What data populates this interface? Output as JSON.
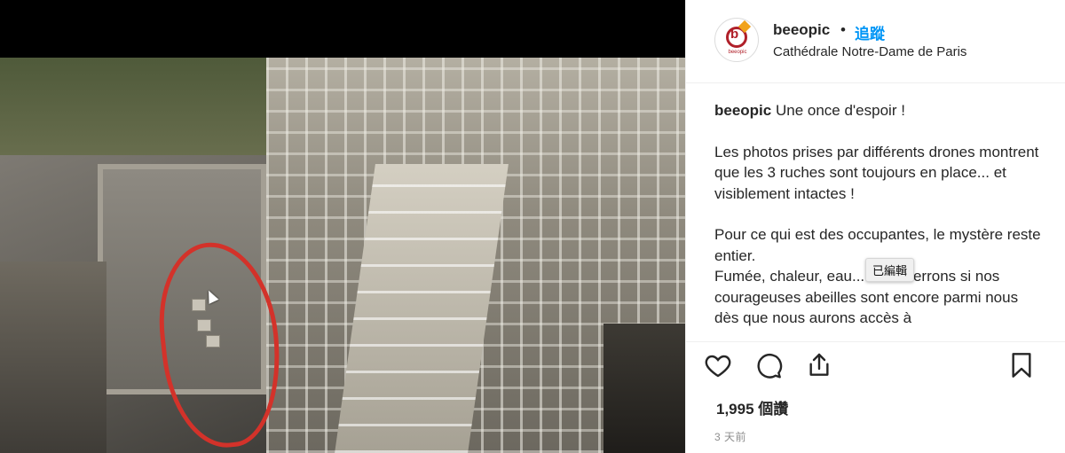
{
  "post": {
    "username": "beeopic",
    "separator": "•",
    "follow_label": "追蹤",
    "location": "Cathédrale Notre-Dame de Paris",
    "avatar_text": "beeopic",
    "avatar_letter": "b"
  },
  "caption": {
    "username": "beeopic",
    "lines": [
      "Une once d'espoir !",
      "Les photos prises par différents drones montrent que les 3 ruches sont toujours en place... et visiblement intactes !",
      "Pour ce qui est des occupantes, le mystère reste entier.",
      "Fumée, chaleur, eau... nous verrons si nos courageuses abeilles sont encore parmi nous dès que nous aurons accès à"
    ]
  },
  "tooltip": {
    "text": "已編輯"
  },
  "actions": {
    "like_icon": "heart-icon",
    "comment_icon": "comment-icon",
    "share_icon": "share-icon",
    "save_icon": "bookmark-icon"
  },
  "stats": {
    "views": "1,995 個讚",
    "time_ago": "3 天前"
  },
  "colors": {
    "accent_blue": "#0095f6",
    "annotation_red": "#d3322a",
    "text_primary": "#262626",
    "text_secondary": "#8e8e8e"
  }
}
